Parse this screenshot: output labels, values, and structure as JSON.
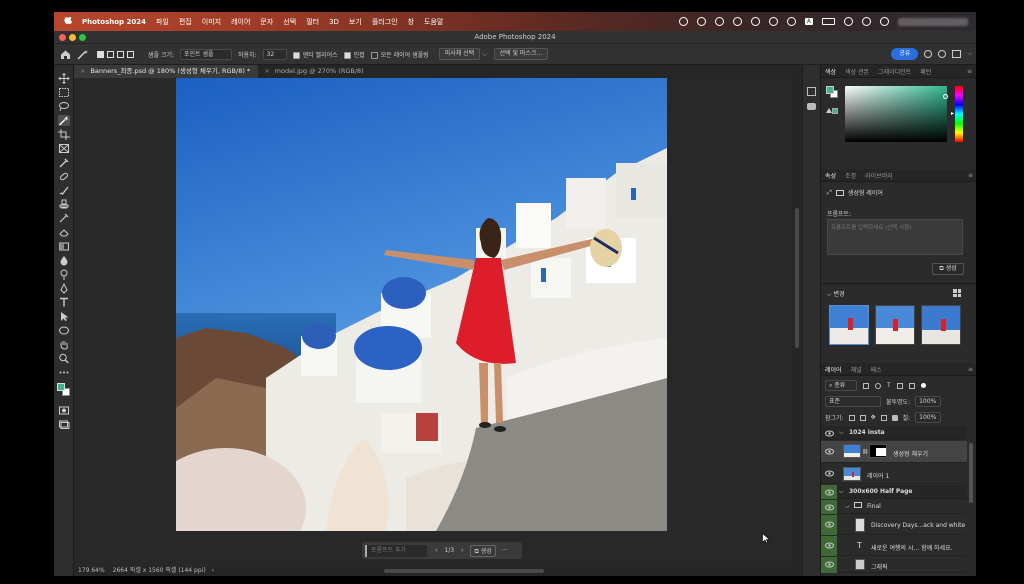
{
  "menubar": {
    "app_name": "Photoshop 2024",
    "items": [
      "파일",
      "편집",
      "이미지",
      "레이어",
      "문자",
      "선택",
      "필터",
      "3D",
      "보기",
      "플러그인",
      "창",
      "도움말"
    ]
  },
  "window": {
    "title": "Adobe Photoshop 2024"
  },
  "options": {
    "sample_size_label": "샘플 크기:",
    "sample_size_value": "포인트 샘플",
    "tolerance_label": "허용치:",
    "tolerance_value": "32",
    "antialias_label": "앤티 앨리어스",
    "contiguous_label": "인접",
    "all_layers_label": "모든 레이어 샘플링",
    "subject_button": "피사체 선택",
    "select_mask_button": "선택 및 마스크...",
    "share_button": "공유"
  },
  "doc_tabs": [
    {
      "label": "Banners_최종.psd @ 180% (생성형 채우기, RGB/8) *"
    },
    {
      "label": "model.jpg @ 270% (RGB/8)"
    }
  ],
  "context_bar": {
    "prompt_placeholder": "프롬프트 추가",
    "page": "1/3",
    "generate_label": "생성",
    "more_label": "···"
  },
  "status": {
    "zoom": "179.64%",
    "doc_info": "2664 픽셀 x 1560 픽셀 (144 ppi)"
  },
  "color_panel": {
    "tabs": [
      "색상",
      "색상 견본",
      "그레이디언트",
      "패턴"
    ],
    "fg_color": "#3db489",
    "bg_color": "#ffffff"
  },
  "properties_panel": {
    "tabs": [
      "속성",
      "조정",
      "라이브러리"
    ],
    "layer_type": "생성형 레이어",
    "prompt_label": "프롬프트:",
    "prompt_placeholder": "프롬프트를 입력하세요 (선택 사항)",
    "generate_button": "생성",
    "variations_label": "변경"
  },
  "layers_panel": {
    "tabs": [
      "레이어",
      "채널",
      "패스"
    ],
    "filter_label": "종류",
    "blend_mode": "표준",
    "opacity_label": "불투명도:",
    "opacity_value": "100%",
    "lock_label": "잠그기:",
    "fill_label": "칠:",
    "fill_value": "100%",
    "layers": [
      {
        "name": "1024 insta",
        "kind": "group"
      },
      {
        "name": "생성형 채우기",
        "kind": "generative"
      },
      {
        "name": "레이어 1",
        "kind": "pixel"
      },
      {
        "name": "300x600 Half Page",
        "kind": "group"
      },
      {
        "name": "Final",
        "kind": "folder"
      },
      {
        "name": "Discovery Days...ack and white",
        "kind": "pixel"
      },
      {
        "name": "새로운 여행의 시... 함께 하세요.",
        "kind": "text"
      },
      {
        "name": "그래픽",
        "kind": "pixel"
      }
    ]
  }
}
